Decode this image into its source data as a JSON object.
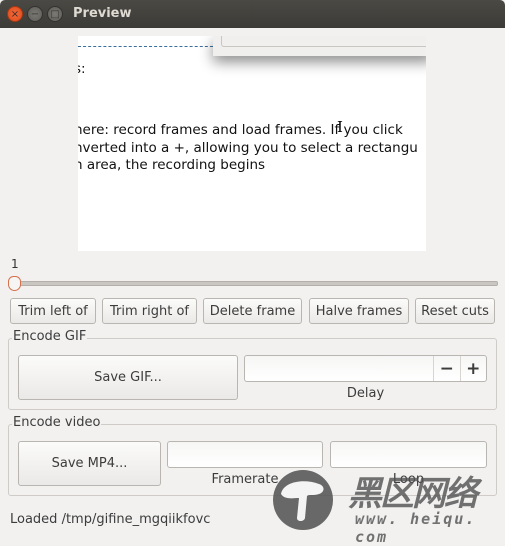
{
  "window": {
    "title": "Preview",
    "controls": {
      "close": "×",
      "minimize": "−",
      "maximize": "□"
    }
  },
  "preview": {
    "lines": [
      "s:",
      "here: record frames and load frames. If you click",
      "nverted into a +, allowing you to select a rectangu",
      "n area, the recording begins"
    ],
    "cursor_glyph": "I"
  },
  "slider": {
    "value": "1",
    "position_fraction": 0.0
  },
  "frame_actions": [
    {
      "label": "Trim left of"
    },
    {
      "label": "Trim right of"
    },
    {
      "label": "Delete frame"
    },
    {
      "label": "Halve frames"
    },
    {
      "label": "Reset cuts"
    }
  ],
  "encode_gif": {
    "title": "Encode GIF",
    "save_label": "Save GIF...",
    "delay": {
      "label": "Delay",
      "value": "",
      "minus": "−",
      "plus": "+"
    }
  },
  "encode_video": {
    "title": "Encode video",
    "save_label": "Save MP4...",
    "framerate": {
      "label": "Framerate",
      "value": "",
      "minus": "−",
      "plus": "+"
    },
    "loop": {
      "label": "Loop",
      "value": "",
      "minus": "−",
      "plus": "+",
      "minus_disabled": true
    }
  },
  "status": "Loaded /tmp/gifine_mgqiikfovc",
  "watermark": {
    "cn": "黑区网络",
    "url": "www. heiqu. com"
  }
}
